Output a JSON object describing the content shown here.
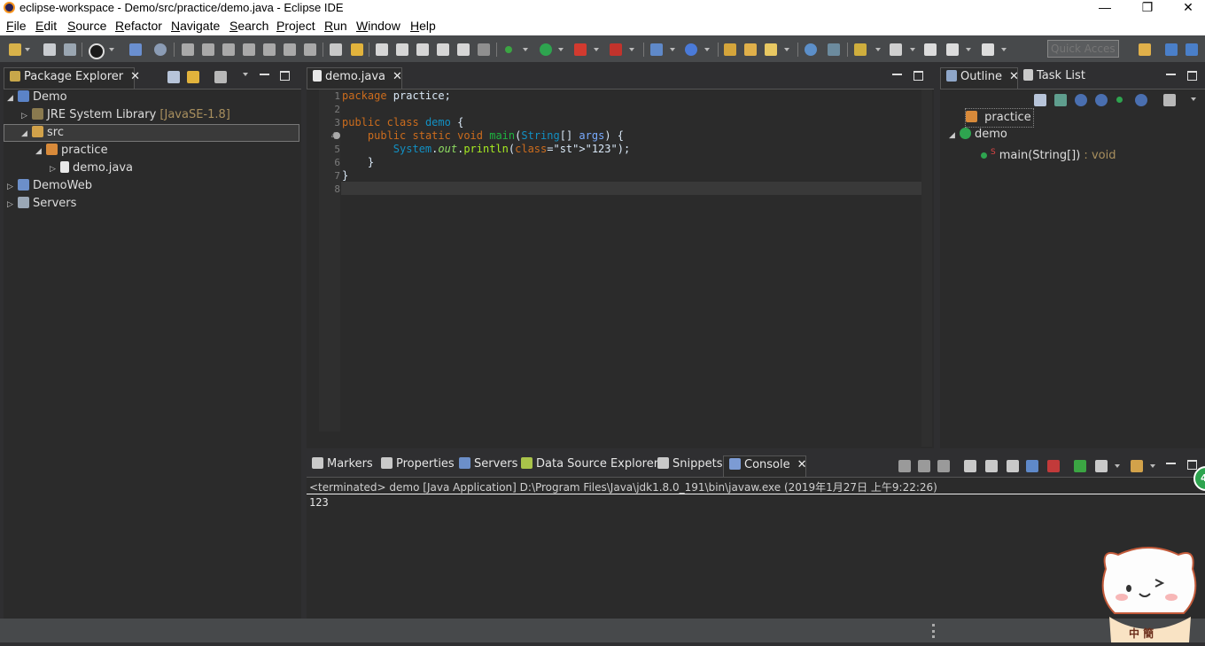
{
  "window": {
    "title": "eclipse-workspace - Demo/src/practice/demo.java - Eclipse IDE",
    "min": "—",
    "max": "❐",
    "close": "✕"
  },
  "menu": [
    "File",
    "Edit",
    "Source",
    "Refactor",
    "Navigate",
    "Search",
    "Project",
    "Run",
    "Window",
    "Help"
  ],
  "quick_access_placeholder": "Quick Access",
  "package_explorer": {
    "tab": "Package Explorer",
    "tree": {
      "demo": "Demo",
      "jre": "JRE System Library",
      "jre_version": "[JavaSE-1.8]",
      "src": "src",
      "practice": "practice",
      "file": "demo.java",
      "demoweb": "DemoWeb",
      "servers": "Servers"
    }
  },
  "editor": {
    "tab": "demo.java",
    "line_numbers": [
      "1",
      "2",
      "3",
      "4",
      "5",
      "6",
      "7",
      "8"
    ],
    "lines": [
      "package practice;",
      "",
      "public class demo {",
      "    public static void main(String[] args) {",
      "        System.out.println(\"123\");",
      "    }",
      "}",
      ""
    ]
  },
  "outline": {
    "tab": "Outline",
    "task_tab": "Task List",
    "package": "practice",
    "class": "demo",
    "method": "main(String[])",
    "return_type": " : void"
  },
  "bottom_tabs": [
    "Markers",
    "Properties",
    "Servers",
    "Data Source Explorer",
    "Snippets",
    "Console"
  ],
  "console": {
    "header": "<terminated> demo [Java Application] D:\\Program Files\\Java\\jdk1.8.0_191\\bin\\javaw.exe (2019年1月27日 上午9:22:26)",
    "output": "123"
  },
  "badge_text": "4",
  "mascot_label": "中 簡"
}
